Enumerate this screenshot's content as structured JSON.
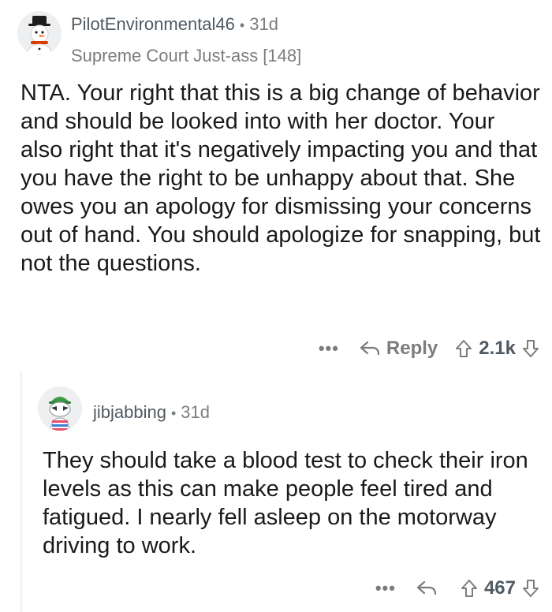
{
  "comments": [
    {
      "author": "PilotEnvironmental46",
      "separator": "•",
      "age": "31d",
      "flair": "Supreme Court Just-ass [148]",
      "body": "NTA. Your right that this is a big change of behavior and should be looked into with her doctor. Your also right that it's negatively impacting you and that you have the right to be unhappy about that. She owes you an apology for dismissing your concerns out of hand. You should apologize for snapping, but not the questions.",
      "actions": {
        "more": "•••",
        "reply_label": "Reply",
        "score": "2.1k"
      }
    },
    {
      "author": "jibjabbing",
      "separator": "•",
      "age": "31d",
      "body": "They should take a blood test to check their iron levels as this can make people feel tired and fatigued. I nearly fell asleep on the motorway driving to work.",
      "actions": {
        "more": "•••",
        "score": "467"
      }
    }
  ],
  "icons": {
    "reply": "reply-arrow-icon",
    "upvote": "upvote-arrow-icon",
    "downvote": "downvote-arrow-icon"
  },
  "colors": {
    "text": "#1a1a1b",
    "muted": "#7c7c7c",
    "author": "#505a62",
    "thread_line": "#edeff1"
  }
}
